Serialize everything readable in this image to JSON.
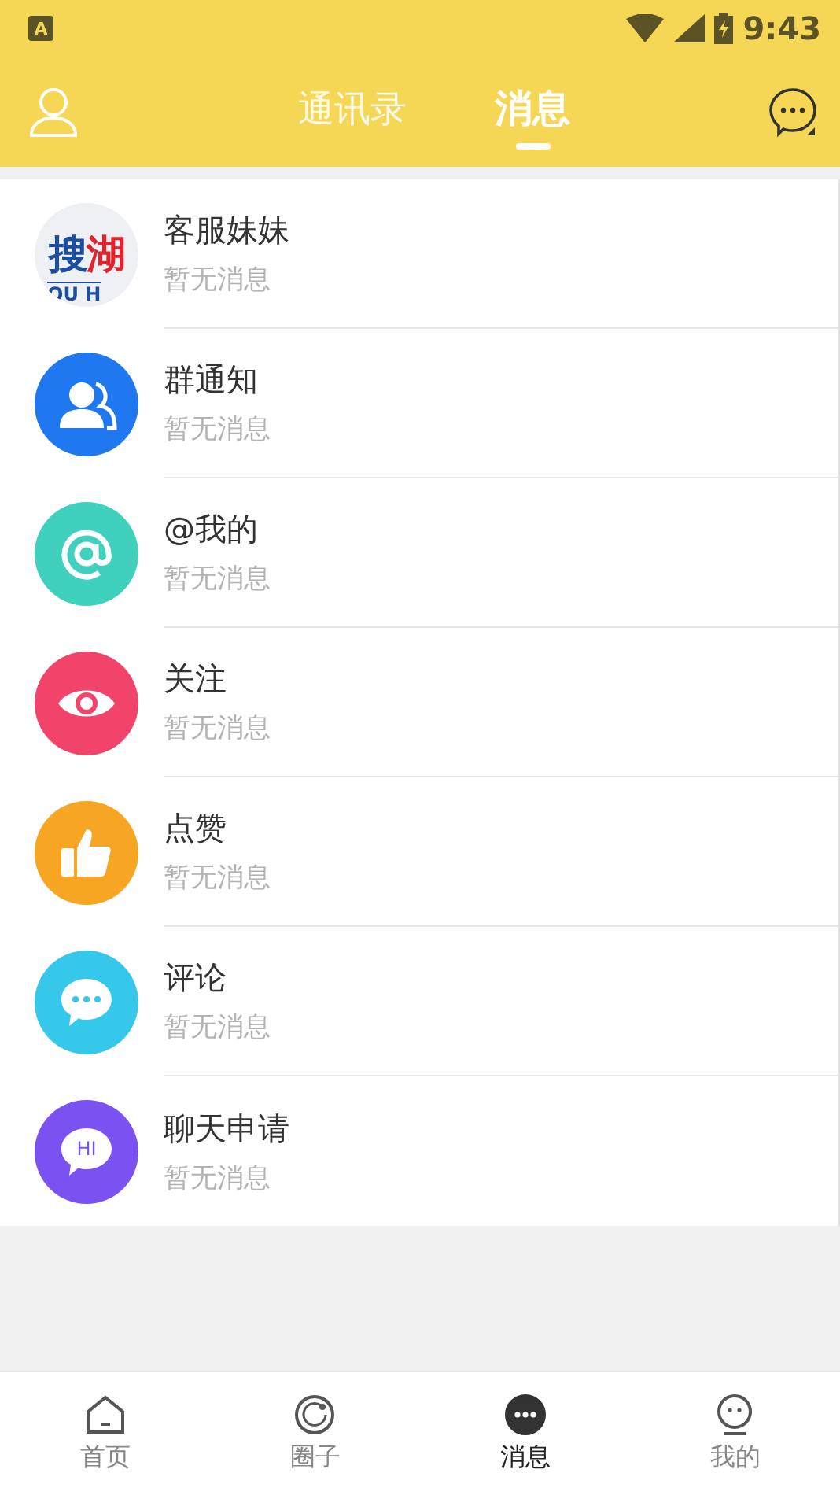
{
  "status_bar": {
    "notification": "A",
    "time": "9:43"
  },
  "header": {
    "tabs": [
      {
        "label": "通讯录",
        "selected": false
      },
      {
        "label": "消息",
        "selected": true
      }
    ]
  },
  "conversations": [
    {
      "kind": "logo",
      "logo": [
        {
          "text": "搜",
          "color": "#1b4e9c"
        },
        {
          "text": "湖",
          "color": "#e3232c"
        }
      ],
      "logo_subtext": "OU H",
      "title": "客服妹妹",
      "subtitle": "暂无消息"
    },
    {
      "kind": "group",
      "color": "#1f78f0",
      "title": "群通知",
      "subtitle": "暂无消息"
    },
    {
      "kind": "at",
      "color": "#3fd1bd",
      "title": "@我的",
      "subtitle": "暂无消息"
    },
    {
      "kind": "eye",
      "color": "#f2436a",
      "title": "关注",
      "subtitle": "暂无消息"
    },
    {
      "kind": "thumb",
      "color": "#f6a623",
      "title": "点赞",
      "subtitle": "暂无消息"
    },
    {
      "kind": "comment",
      "color": "#35c8ea",
      "title": "评论",
      "subtitle": "暂无消息"
    },
    {
      "kind": "hi",
      "color": "#7a52f2",
      "icon_text": "HI",
      "title": "聊天申请",
      "subtitle": "暂无消息"
    }
  ],
  "bottom_nav": [
    {
      "kind": "home",
      "label": "首页",
      "selected": false
    },
    {
      "kind": "circle",
      "label": "圈子",
      "selected": false
    },
    {
      "kind": "message",
      "label": "消息",
      "selected": true
    },
    {
      "kind": "me",
      "label": "我的",
      "selected": false
    }
  ]
}
